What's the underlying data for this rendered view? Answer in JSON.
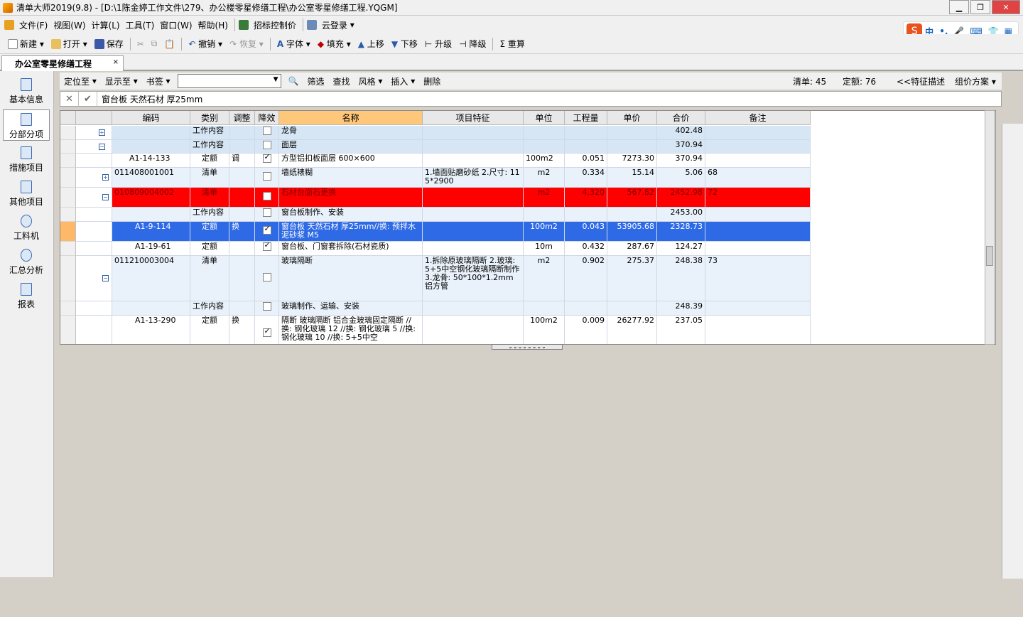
{
  "window": {
    "title": "清单大师2019(9.8) - [D:\\1陈金婷工作文件\\279、办公楼零星修缮工程\\办公室零星修缮工程.YQGM]"
  },
  "menu": {
    "items": [
      "文件(F)",
      "视图(W)",
      "计算(L)",
      "工具(T)",
      "窗口(W)",
      "帮助(H)"
    ],
    "extra": [
      "招标控制价",
      "云登录"
    ]
  },
  "ime": {
    "items": [
      "S",
      "中",
      "•,",
      "🎤",
      "⌨",
      "👕",
      "▦"
    ]
  },
  "toolbar": {
    "items": [
      "新建",
      "打开",
      "保存",
      "撤销",
      "恢复",
      "字体",
      "填充",
      "上移",
      "下移",
      "升级",
      "降级",
      "重算"
    ]
  },
  "doc_tab": {
    "label": "办公室零星修缮工程",
    "close": "×"
  },
  "nav": {
    "items": [
      "基本信息",
      "分部分项",
      "措施项目",
      "其他项目",
      "工料机",
      "汇总分析",
      "报表"
    ]
  },
  "subbar": {
    "items": [
      "定位至",
      "显示至",
      "书签"
    ],
    "items2": [
      "筛选",
      "查找",
      "风格",
      "插入",
      "删除"
    ],
    "bill_label": "清单: 45",
    "quota_label": "定额: 76",
    "feature_label": "<<特征描述",
    "price_plan": "组价方案"
  },
  "editbar": {
    "cancel": "✕",
    "confirm": "✔",
    "text": "窗台板 天然石材 厚25mm"
  },
  "grid1": {
    "headers": [
      "编码",
      "类别",
      "调整",
      "降效",
      "名称",
      "项目特征",
      "单位",
      "工程量",
      "单价",
      "合价",
      "备注"
    ],
    "rows": [
      {
        "code": "",
        "cat": "工作内容",
        "adj": "",
        "chk": false,
        "name": "龙骨",
        "feat": "",
        "unit": "",
        "qty": "",
        "price": "",
        "total": "402.48",
        "note": ""
      },
      {
        "code": "",
        "cat": "工作内容",
        "adj": "",
        "chk": false,
        "name": "面层",
        "feat": "",
        "unit": "",
        "qty": "",
        "price": "",
        "total": "370.94",
        "note": ""
      },
      {
        "code": "A1-14-133",
        "cat": "定额",
        "adj": "调",
        "chk": true,
        "name": "方型铝扣板面层 600×600",
        "feat": "",
        "unit": "100m2",
        "qty": "0.051",
        "price": "7273.30",
        "total": "370.94",
        "note": ""
      },
      {
        "code": "011408001001",
        "cat": "清单",
        "adj": "",
        "chk": false,
        "name": "墙纸裱糊",
        "feat": "1.墙面贴磨砂纸 2.尺寸: 115*2900",
        "unit": "m2",
        "qty": "0.334",
        "price": "15.14",
        "total": "5.06",
        "note": "68"
      },
      {
        "code": "010809004002",
        "cat": "清单",
        "adj": "",
        "chk": false,
        "name": "石材台面石更换",
        "feat": "",
        "unit": "m2",
        "qty": "4.320",
        "price": "567.82",
        "total": "2452.98",
        "note": "72"
      },
      {
        "code": "",
        "cat": "工作内容",
        "adj": "",
        "chk": false,
        "name": "窗台板制作、安装",
        "feat": "",
        "unit": "",
        "qty": "",
        "price": "",
        "total": "2453.00",
        "note": ""
      },
      {
        "code": "A1-9-114",
        "cat": "定额",
        "adj": "换",
        "chk": true,
        "name": "窗台板 天然石材 厚25mm//换: 预拌水泥砂浆 M5",
        "feat": "",
        "unit": "100m2",
        "qty": "0.043",
        "price": "53905.68",
        "total": "2328.73",
        "note": ""
      },
      {
        "code": "A1-19-61",
        "cat": "定额",
        "adj": "",
        "chk": true,
        "name": "窗台板、门窗套拆除(石材瓷质)",
        "feat": "",
        "unit": "10m",
        "qty": "0.432",
        "price": "287.67",
        "total": "124.27",
        "note": ""
      },
      {
        "code": "011210003004",
        "cat": "清单",
        "adj": "",
        "chk": false,
        "name": "玻璃隔断",
        "feat": "1.拆除原玻璃隔断 2.玻璃: 5+5中空钢化玻璃隔断制作 3.龙骨: 50*100*1.2mm铝方管",
        "unit": "m2",
        "qty": "0.902",
        "price": "275.37",
        "total": "248.38",
        "note": "73"
      },
      {
        "code": "",
        "cat": "工作内容",
        "adj": "",
        "chk": false,
        "name": "玻璃制作、运输、安装",
        "feat": "",
        "unit": "",
        "qty": "",
        "price": "",
        "total": "248.39",
        "note": ""
      },
      {
        "code": "A1-13-290",
        "cat": "定额",
        "adj": "换",
        "chk": true,
        "name": "隔断 玻璃隔断 铝合金玻璃固定隔断 //换: 钢化玻璃 12 //换: 钢化玻璃 5 //换: 钢化玻璃 10 //换: 5+5中空",
        "feat": "",
        "unit": "100m2",
        "qty": "0.009",
        "price": "26277.92",
        "total": "237.05",
        "note": ""
      }
    ]
  },
  "grabber": "⌄⌄⌄⌄⌄⌄⌄⌄"
}
